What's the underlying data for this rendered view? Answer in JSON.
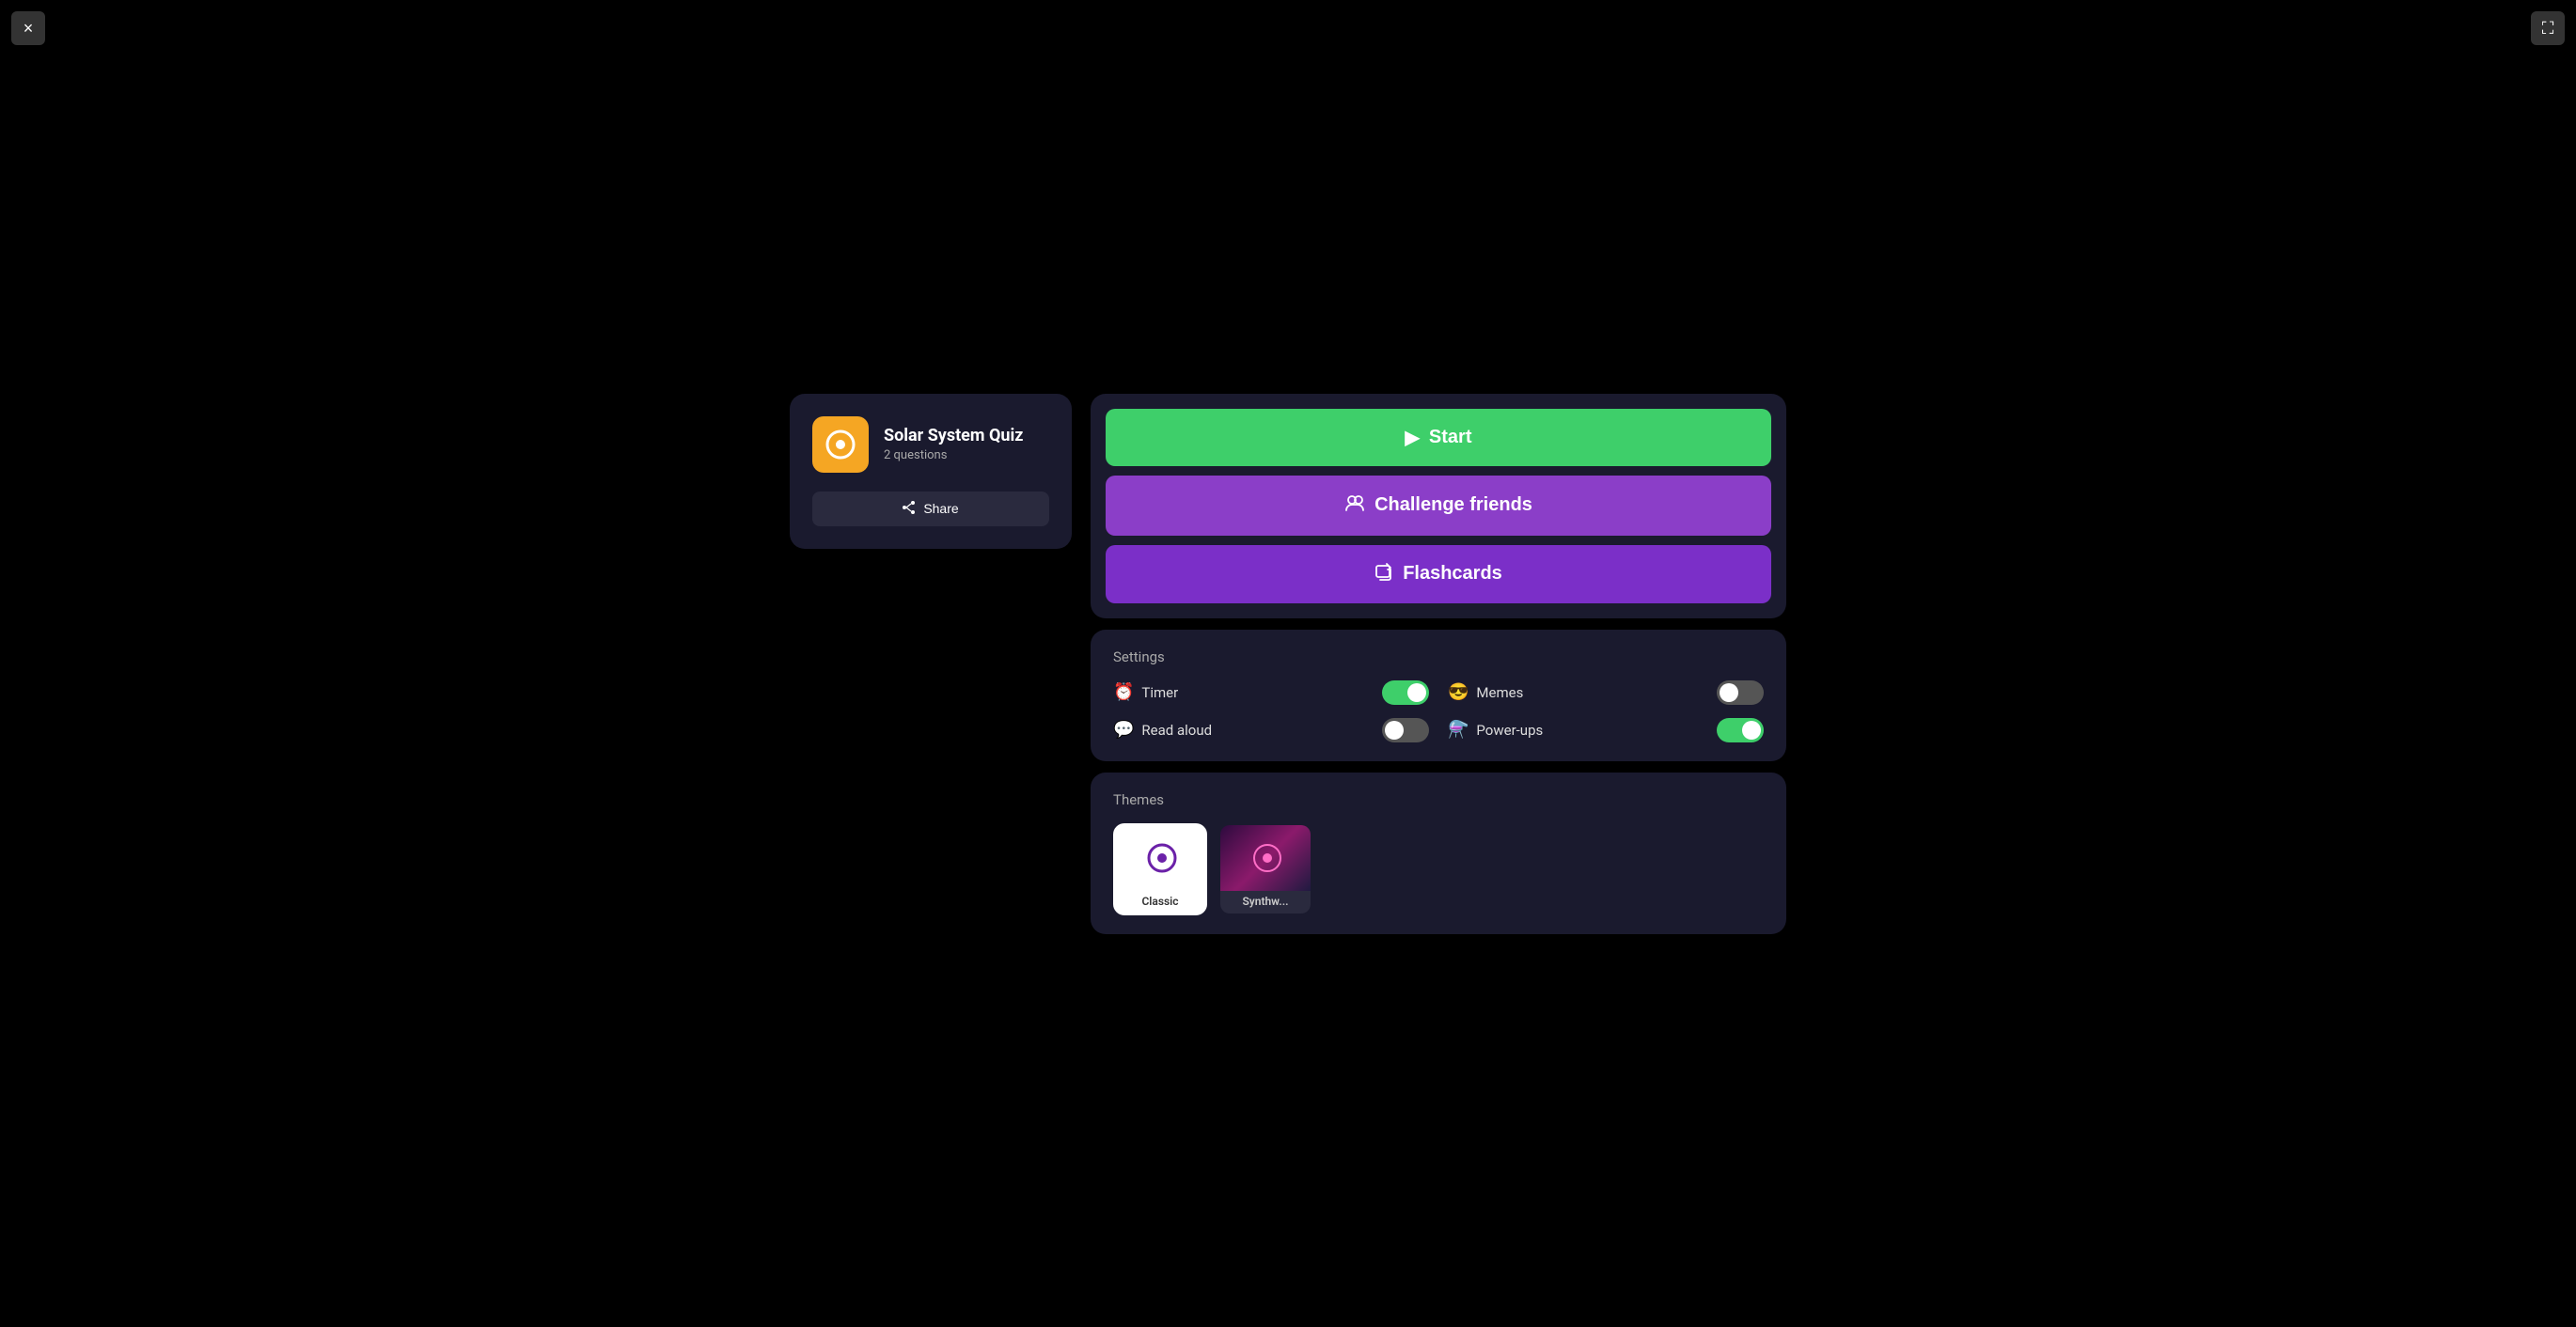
{
  "window": {
    "close_label": "×",
    "fullscreen_label": "⛶"
  },
  "left_panel": {
    "quiz_icon": "◎",
    "quiz_title": "Solar System Quiz",
    "quiz_subtitle": "2 questions",
    "share_label": "Share",
    "share_icon": "share"
  },
  "actions": {
    "start_label": "Start",
    "challenge_label": "Challenge friends",
    "flashcards_label": "Flashcards"
  },
  "settings": {
    "section_title": "Settings",
    "timer_label": "Timer",
    "timer_on": true,
    "memes_label": "Memes",
    "memes_on": false,
    "read_aloud_label": "Read aloud",
    "read_aloud_on": false,
    "powerups_label": "Power-ups",
    "powerups_on": true
  },
  "themes": {
    "section_title": "Themes",
    "items": [
      {
        "id": "classic",
        "label": "Classic",
        "active": true
      },
      {
        "id": "synthwave",
        "label": "Synthw...",
        "active": false
      }
    ]
  }
}
